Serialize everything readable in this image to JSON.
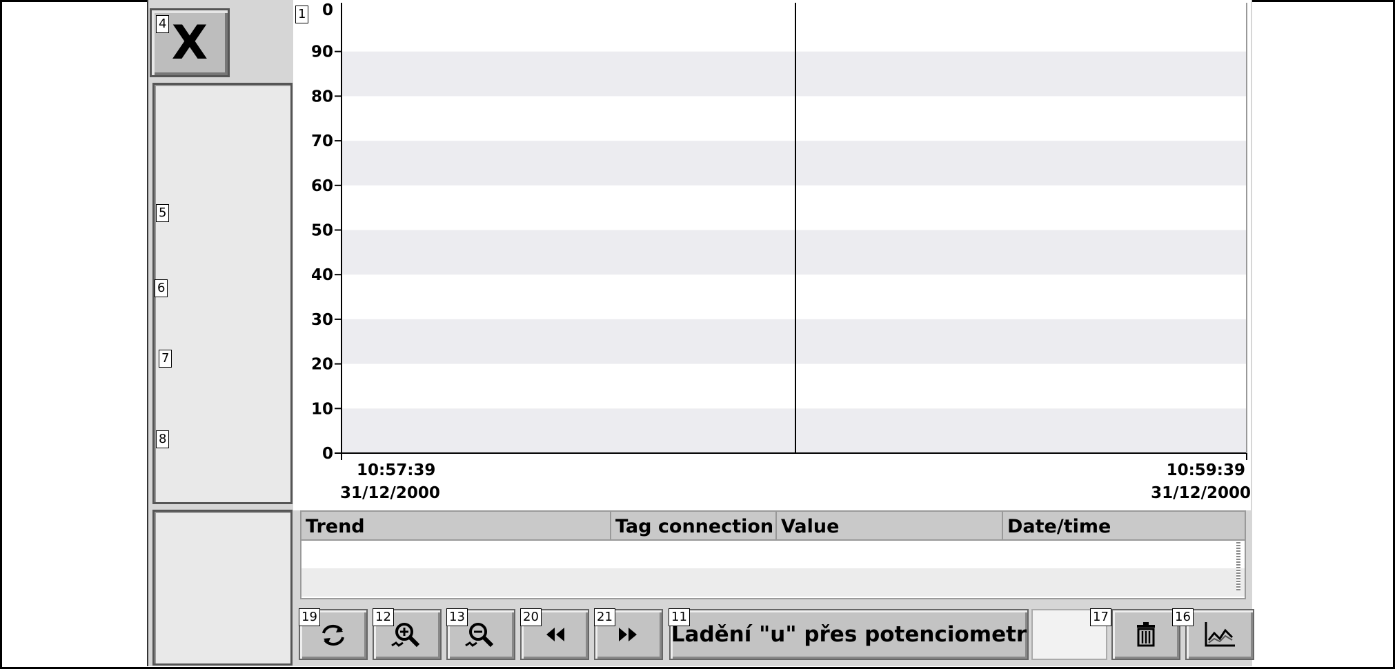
{
  "close_button": {
    "label": "X",
    "tag": "4"
  },
  "side_tags": [
    "5",
    "6",
    "7",
    "8"
  ],
  "chart_tag": "1",
  "chart_data": {
    "type": "line",
    "series": [],
    "x_labels": [
      {
        "time": "10:57:39",
        "date": "31/12/2000"
      },
      {
        "time": "10:59:39",
        "date": "31/12/2000"
      }
    ],
    "ylim": [
      0,
      100
    ],
    "yticks": [
      0,
      10,
      20,
      30,
      40,
      50,
      60,
      70,
      80,
      90
    ],
    "top_tick_label": "0",
    "band_color": "#ececf0",
    "grid": "horizontal bands"
  },
  "table": {
    "headers": [
      "Trend",
      "Tag connection",
      "Value",
      "Date/time"
    ],
    "rows": []
  },
  "toolbar": {
    "buttons": [
      {
        "tag": "19",
        "icon": "refresh-icon"
      },
      {
        "tag": "12",
        "icon": "zoom-in-icon"
      },
      {
        "tag": "13",
        "icon": "zoom-out-icon"
      },
      {
        "tag": "20",
        "icon": "rewind-icon"
      },
      {
        "tag": "21",
        "icon": "fast-forward-icon"
      }
    ],
    "description": {
      "tag": "11",
      "label": "Ladění \"u\" přes potenciometr"
    },
    "delete": {
      "tag": "17",
      "icon": "trash-icon"
    },
    "chart": {
      "tag": "16",
      "icon": "chart-icon"
    }
  }
}
